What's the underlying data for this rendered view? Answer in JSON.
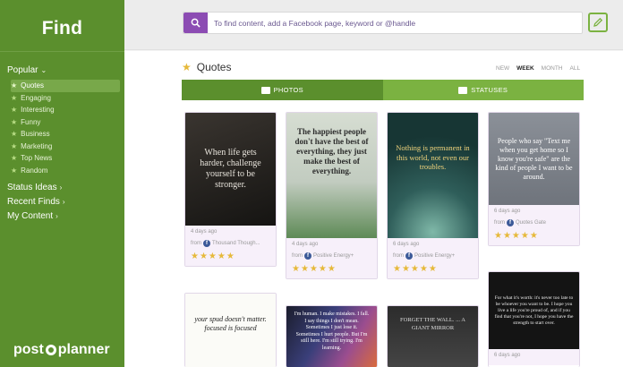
{
  "sidebar": {
    "title": "Find",
    "popular_label": "Popular",
    "items": [
      {
        "label": "Quotes",
        "active": true
      },
      {
        "label": "Engaging"
      },
      {
        "label": "Interesting"
      },
      {
        "label": "Funny"
      },
      {
        "label": "Business"
      },
      {
        "label": "Marketing"
      },
      {
        "label": "Top News"
      },
      {
        "label": "Random"
      }
    ],
    "status_ideas": "Status Ideas",
    "recent_finds": "Recent Finds",
    "my_content": "My Content",
    "logo_left": "post",
    "logo_right": "planner"
  },
  "search": {
    "placeholder": "To find content, add a Facebook page, keyword or @handle"
  },
  "main": {
    "title": "Quotes",
    "periods": [
      "NEW",
      "WEEK",
      "MONTH",
      "ALL"
    ],
    "active_period": "WEEK",
    "tabs": {
      "photos": "PHOTOS",
      "statuses": "STATUSES"
    }
  },
  "cards": [
    {
      "quote": "When life gets harder, challenge yourself to be stronger.",
      "date": "4 days ago",
      "from_label": "from",
      "source": "Thousand Though...",
      "rating": 5
    },
    {
      "quote": "The happiest people don't have the best of everything, they just make the best of everything.",
      "date": "4 days ago",
      "from_label": "from",
      "source": "Positive Energy+",
      "rating": 5
    },
    {
      "quote": "Nothing is permanent in this world, not even our troubles.",
      "date": "6 days ago",
      "from_label": "from",
      "source": "Positive Energy+",
      "rating": 5
    },
    {
      "quote": "People who say \"Text me when you get home so I know you're safe\" are the kind of people I want to be around.",
      "date": "6 days ago",
      "from_label": "from",
      "source": "Quotes Gate",
      "rating": 5
    },
    {
      "quote": "your spud doesn't matter. focused is focused",
      "date": "",
      "from_label": "",
      "source": "",
      "rating": 0
    },
    {
      "quote": "I'm human. I make mistakes. I fall. I say things I don't mean. Sometimes I just lose it. Sometimes I hurt people. But I'm still here. I'm still trying. I'm learning.",
      "date": "",
      "from_label": "",
      "source": "",
      "rating": 0
    },
    {
      "quote": "FORGET THE WALL. ... A GIANT MIRROR",
      "date": "",
      "from_label": "",
      "source": "",
      "rating": 0
    },
    {
      "quote": "For what it's worth: it's never too late to be whoever you want to be. I hope you live a life you're proud of, and if you find that you're not, I hope you have the strength to start over.",
      "date": "6 days ago",
      "from_label": "",
      "source": "",
      "rating": 0
    }
  ],
  "colors": {
    "sidebar": "#5b8f2d",
    "accent": "#7bb241",
    "search_button": "#8c4cb3",
    "star": "#e6b93a"
  }
}
